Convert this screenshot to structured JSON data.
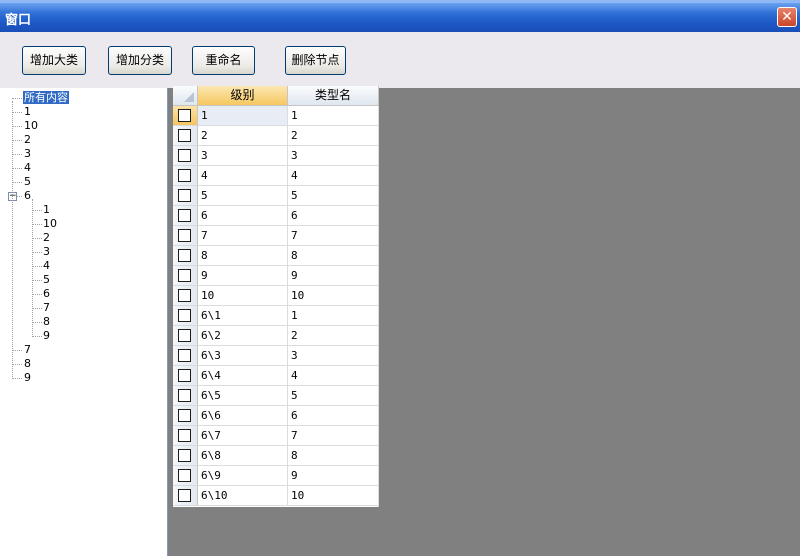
{
  "window": {
    "title": "窗口",
    "close_glyph": "✕"
  },
  "toolbar": {
    "add_major": "增加大类",
    "add_sub": "增加分类",
    "rename": "重命名",
    "delete_node": "删除节点"
  },
  "tree": {
    "root": "所有内容",
    "top_items": [
      "1",
      "10",
      "2",
      "3",
      "4",
      "5",
      "6"
    ],
    "expander_glyph": "−",
    "children_of_6": [
      "1",
      "10",
      "2",
      "3",
      "4",
      "5",
      "6",
      "7",
      "8",
      "9"
    ],
    "bottom_items": [
      "7",
      "8",
      "9"
    ]
  },
  "grid": {
    "col_level": "级别",
    "col_type_name": "类型名",
    "rows": [
      {
        "level": "1",
        "name": "1"
      },
      {
        "level": "2",
        "name": "2"
      },
      {
        "level": "3",
        "name": "3"
      },
      {
        "level": "4",
        "name": "4"
      },
      {
        "level": "5",
        "name": "5"
      },
      {
        "level": "6",
        "name": "6"
      },
      {
        "level": "7",
        "name": "7"
      },
      {
        "level": "8",
        "name": "8"
      },
      {
        "level": "9",
        "name": "9"
      },
      {
        "level": "10",
        "name": "10"
      },
      {
        "level": "6\\1",
        "name": "1"
      },
      {
        "level": "6\\2",
        "name": "2"
      },
      {
        "level": "6\\3",
        "name": "3"
      },
      {
        "level": "6\\4",
        "name": "4"
      },
      {
        "level": "6\\5",
        "name": "5"
      },
      {
        "level": "6\\6",
        "name": "6"
      },
      {
        "level": "6\\7",
        "name": "7"
      },
      {
        "level": "6\\8",
        "name": "8"
      },
      {
        "level": "6\\9",
        "name": "9"
      },
      {
        "level": "6\\10",
        "name": "10"
      }
    ]
  }
}
